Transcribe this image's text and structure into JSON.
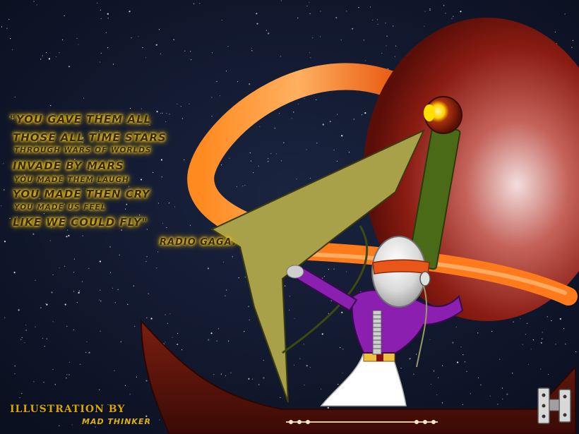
{
  "quote": {
    "line1": "\"you gave them all",
    "line2": "those all time stars",
    "line3": "through wars of worlds",
    "line4": "invade by mars",
    "line5": "you made them laugh",
    "line6": "you made then cry",
    "line7": "you made us feel",
    "line8": "like we could fly\"",
    "attribution": "radio gaga."
  },
  "credit": {
    "label": "illustration by",
    "artist": "mad thinker"
  },
  "colors": {
    "space": "#131b30",
    "planet": "#8a1c12",
    "ring": "#ff7a1a",
    "sail": "#a8a14a",
    "mast": "#4a6a18",
    "hull": "#5a130a",
    "jacket": "#8a1fb0",
    "glow": "#ffd200"
  }
}
